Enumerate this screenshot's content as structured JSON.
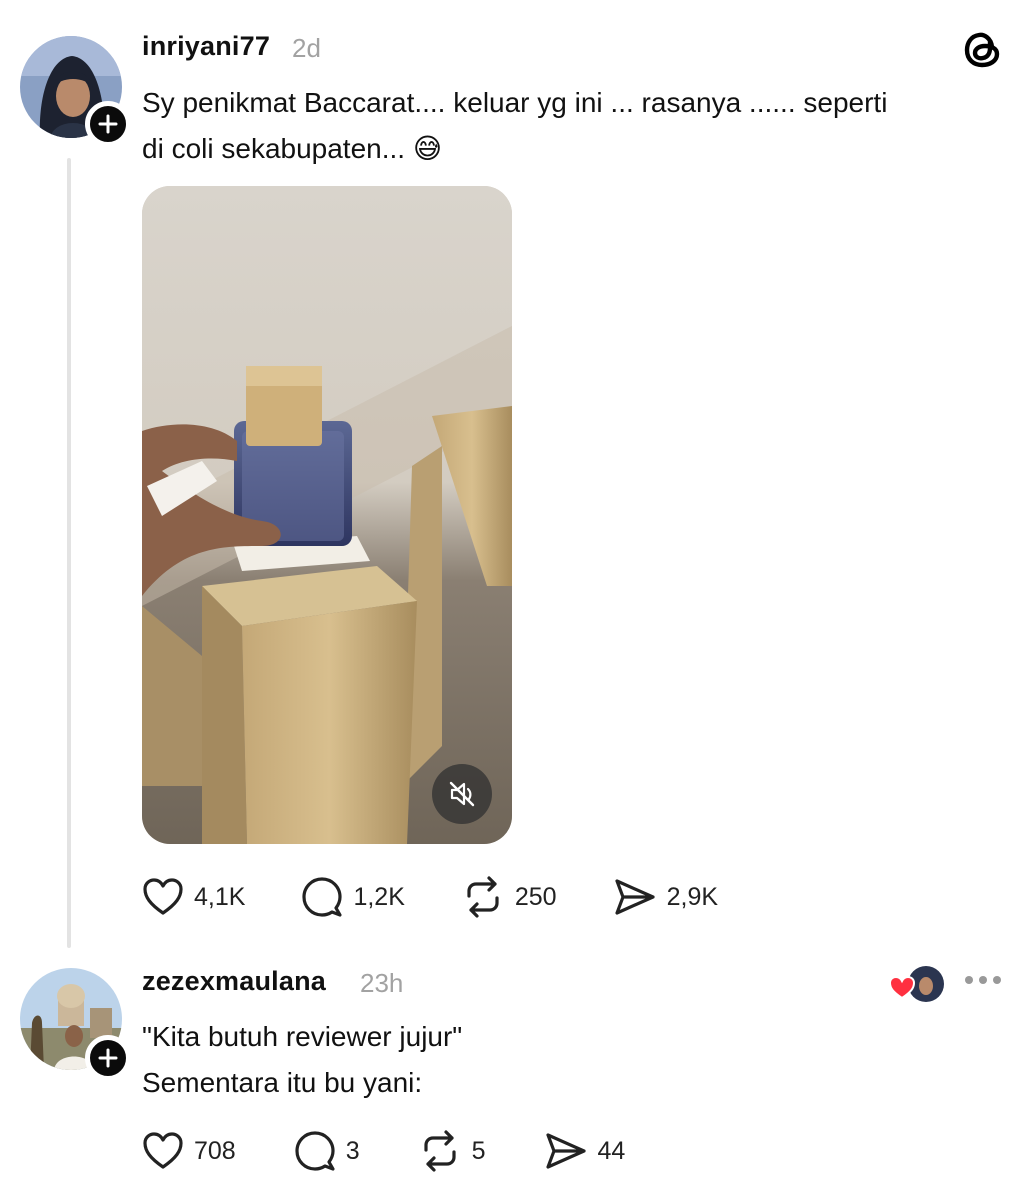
{
  "app": {
    "logo_icon": "threads-logo-icon"
  },
  "post": {
    "username": "inriyani77",
    "time": "2d",
    "text_lines": [
      "Sy penikmat Baccarat.... keluar yg ini ... rasanya ...... seperti",
      "di coli sekabupaten... 😅"
    ],
    "media": {
      "type": "video",
      "muted": true
    },
    "actions": {
      "likes": "4,1K",
      "replies": "1,2K",
      "reposts": "250",
      "shares": "2,9K"
    }
  },
  "reply": {
    "username": "zezexmaulana",
    "time": "23h",
    "text_lines": [
      "\"Kita butuh reviewer jujur\"",
      "Sementara itu bu yani:"
    ],
    "actions": {
      "likes": "708",
      "replies": "3",
      "reposts": "5",
      "shares": "44"
    }
  },
  "colors": {
    "heart_red": "#ff3040",
    "text_primary": "#111111",
    "text_secondary": "#a2a2a2",
    "thread_line": "#e3e3e3"
  }
}
